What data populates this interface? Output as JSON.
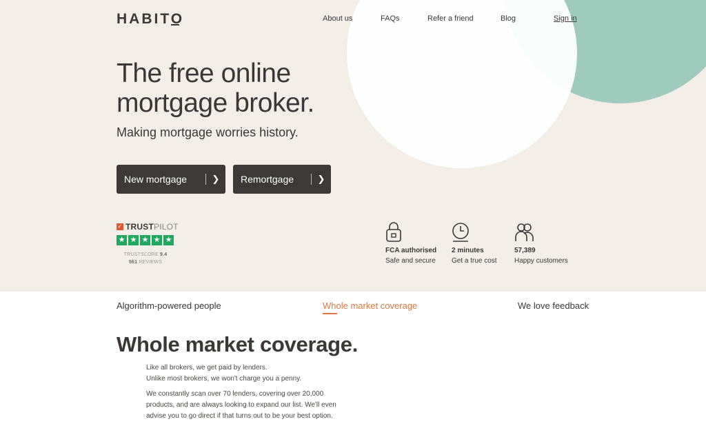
{
  "brand": {
    "logo": "HABITO"
  },
  "nav": {
    "about": "About us",
    "faqs": "FAQs",
    "refer": "Refer a friend",
    "blog": "Blog",
    "signin": "Sign in"
  },
  "hero": {
    "headline": "The free online mortgage broker.",
    "subhead": "Making mortgage worries history.",
    "buttons": {
      "new_mortgage": "New mortgage",
      "remortgage": "Remortgage"
    }
  },
  "trustpilot": {
    "brand_bold": "TRUST",
    "brand_light": "PILOT",
    "score_label": "TRUSTSCORE",
    "score": "9.4",
    "reviews_count": "561",
    "reviews_label": "REVIEWS",
    "stars": 5
  },
  "features": [
    {
      "icon": "lock-icon",
      "title": "FCA authorised",
      "subtitle": "Safe and secure"
    },
    {
      "icon": "clock-icon",
      "title": "2 minutes",
      "subtitle": "Get a true cost"
    },
    {
      "icon": "people-icon",
      "title": "57,389",
      "subtitle": "Happy customers"
    }
  ],
  "tabs": {
    "algorithm": "Algorithm-powered people",
    "whole_market": "Whole market coverage",
    "feedback": "We love feedback",
    "active": "whole_market"
  },
  "section": {
    "title": "Whole market coverage.",
    "para1_line1": "Like all brokers, we get paid by lenders.",
    "para1_line2": "Unlike most brokers, we won't charge you a penny.",
    "para2": "We constantly scan over 70 lenders, covering over 20,000 products, and are always looking to expand our list. We'll even advise you to go direct if that turns out to be your best option."
  },
  "colors": {
    "hero_bg": "#f3efe8",
    "accent_orange": "#e0763f",
    "mint": "#9fcbbd",
    "dark_button": "#3d3938",
    "trustpilot_green": "#1ea860"
  }
}
